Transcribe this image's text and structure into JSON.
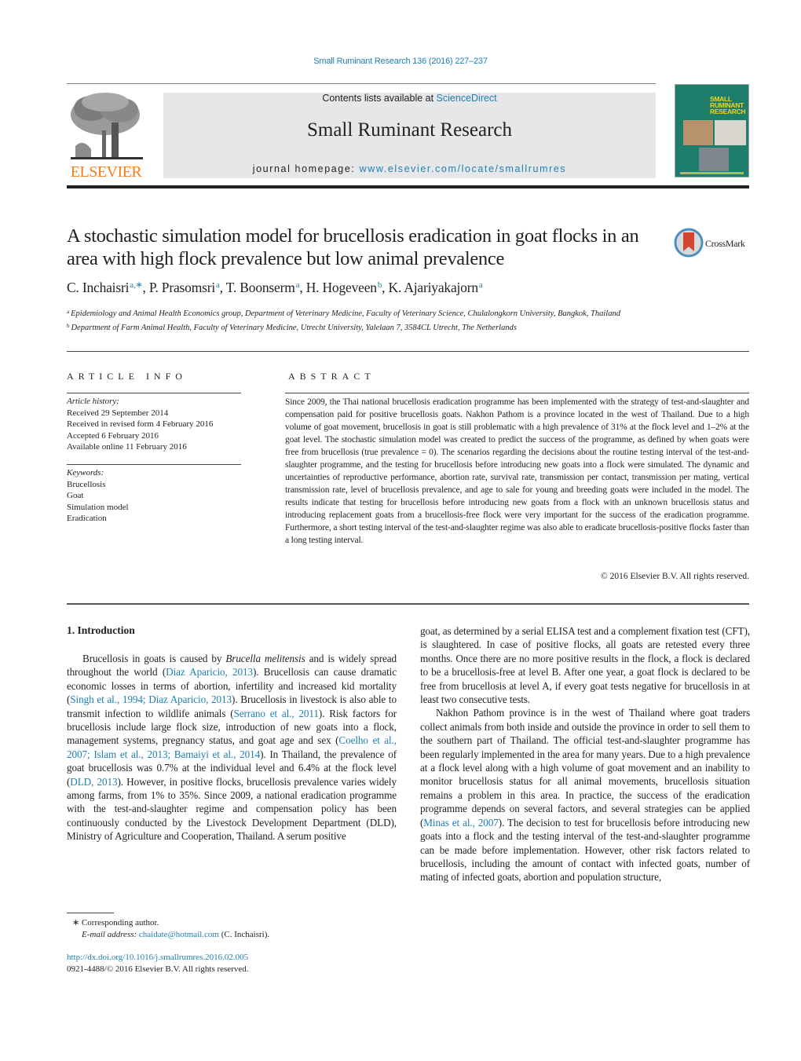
{
  "header": {
    "citation": "Small Ruminant Research 136 (2016) 227–237",
    "contents_prefix": "Contents lists available at ",
    "contents_link": "ScienceDirect",
    "journal_name": "Small Ruminant Research",
    "homepage_prefix": "journal homepage: ",
    "homepage_link": "www.elsevier.com/locate/smallrumres",
    "publisher_logo_text": "ELSEVIER",
    "cover_title_lines": [
      "SMALL",
      "RUMINANT",
      "RESEARCH"
    ],
    "colors": {
      "link": "#1f7fb3",
      "publisher_orange": "#f07f1b",
      "banner_bg": "#e6e7e8",
      "cover_green": "#1f7d6b",
      "cover_yellow": "#f3d21b"
    }
  },
  "article": {
    "title": "A stochastic simulation model for brucellosis eradication in goat flocks in an area with high flock prevalence but low animal prevalence",
    "crossmark_label": "CrossMark",
    "authors": [
      {
        "name": "C. Inchaisri",
        "sup": "a,∗"
      },
      {
        "name": "P. Prasomsri",
        "sup": "a"
      },
      {
        "name": "T. Boonserm",
        "sup": "a"
      },
      {
        "name": "H. Hogeveen",
        "sup": "b"
      },
      {
        "name": "K. Ajariyakajorn",
        "sup": "a"
      }
    ],
    "affiliations": [
      {
        "mark": "a",
        "text": "Epidemiology and Animal Health Economics group, Department of Veterinary Medicine, Faculty of Veterinary Science, Chulalongkorn University, Bangkok, Thailand"
      },
      {
        "mark": "b",
        "text": "Department of Farm Animal Health, Faculty of Veterinary Medicine, Utrecht University, Yalelaan 7, 3584CL Utrecht, The Netherlands"
      }
    ]
  },
  "article_info": {
    "heading": "ARTICLE INFO",
    "history_label": "Article history:",
    "history": [
      "Received 29 September 2014",
      "Received in revised form 4 February 2016",
      "Accepted 6 February 2016",
      "Available online 11 February 2016"
    ],
    "keywords_label": "Keywords:",
    "keywords": [
      "Brucellosis",
      "Goat",
      "Simulation model",
      "Eradication"
    ]
  },
  "abstract": {
    "heading": "ABSTRACT",
    "text": "Since 2009, the Thai national brucellosis eradication programme has been implemented with the strategy of test-and-slaughter and compensation paid for positive brucellosis goats. Nakhon Pathom is a province located in the west of Thailand. Due to a high volume of goat movement, brucellosis in goat is still problematic with a high prevalence of 31% at the flock level and 1–2% at the goat level. The stochastic simulation model was created to predict the success of the programme, as defined by when goats were free from brucellosis (true prevalence = 0). The scenarios regarding the decisions about the routine testing interval of the test-and-slaughter programme, and the testing for brucellosis before introducing new goats into a flock were simulated. The dynamic and uncertainties of reproductive performance, abortion rate, survival rate, transmission per contact, transmission per mating, vertical transmission rate, level of brucellosis prevalence, and age to sale for young and breeding goats were included in the model. The results indicate that testing for brucellosis before introducing new goats from a flock with an unknown brucellosis status and introducing replacement goats from a brucellosis-free flock were very important for the success of the eradication programme. Furthermore, a short testing interval of the test-and-slaughter regime was also able to eradicate brucellosis-positive flocks faster than a long testing interval.",
    "copyright": "© 2016 Elsevier B.V. All rights reserved."
  },
  "body": {
    "section_heading": "1.  Introduction",
    "left_column": [
      {
        "t": "Brucellosis in goats is caused by "
      },
      {
        "t": "Brucella melitensis",
        "style": "italic"
      },
      {
        "t": " and is widely spread throughout the world ("
      },
      {
        "t": "Diaz Aparicio, 2013",
        "style": "link"
      },
      {
        "t": "). Brucellosis can cause dramatic economic losses in terms of abortion, infertility and increased kid mortality ("
      },
      {
        "t": "Singh et al., 1994; Diaz Aparicio, 2013",
        "style": "link"
      },
      {
        "t": "). Brucellosis in livestock is also able to transmit infection to wildlife animals ("
      },
      {
        "t": "Serrano et al., 2011",
        "style": "link"
      },
      {
        "t": "). Risk factors for brucellosis include large flock size, introduction of new goats into a flock, management systems, pregnancy status, and goat age and sex ("
      },
      {
        "t": "Coelho et al., 2007; Islam et al., 2013; Bamaiyi et al., 2014",
        "style": "link"
      },
      {
        "t": "). In Thailand, the prevalence of goat brucellosis was 0.7% at the individual level and 6.4% at the flock level ("
      },
      {
        "t": "DLD, 2013",
        "style": "link"
      },
      {
        "t": "). However, in positive flocks, brucellosis prevalence varies widely among farms, from 1% to 35%. Since 2009, a national eradication programme with the test-and-slaughter regime and compensation policy has been continuously conducted by the Livestock Development Department (DLD), Ministry of Agriculture and Cooperation, Thailand. A serum positive"
      }
    ],
    "right_column_p1": "goat, as determined by a serial ELISA test and a complement fixation test (CFT), is slaughtered. In case of positive flocks, all goats are retested every three months. Once there are no more positive results in the flock, a flock is declared to be a brucellosis-free at level B. After one year, a goat flock is declared to be free from brucellosis at level A, if every goat tests negative for brucellosis in at least two consecutive tests.",
    "right_column_p2": [
      {
        "t": "Nakhon Pathom province is in the west of Thailand where goat traders collect animals from both inside and outside the province in order to sell them to the southern part of Thailand. The official test-and-slaughter programme has been regularly implemented in the area for many years. Due to a high prevalence at a flock level along with a high volume of goat movement and an inability to monitor brucellosis status for all animal movements, brucellosis situation remains a problem in this area. In practice, the success of the eradication programme depends on several factors, and several strategies can be applied ("
      },
      {
        "t": "Minas et al., 2007",
        "style": "link"
      },
      {
        "t": "). The decision to test for brucellosis before introducing new goats into a flock and the testing interval of the test-and-slaughter programme can be made before implementation. However, other risk factors related to brucellosis, including the amount of contact with infected goats, number of mating of infected goats, abortion and population structure,"
      }
    ]
  },
  "footnotes": {
    "corresponding": "∗  Corresponding author.",
    "email_label": "E-mail address: ",
    "email": "chaidate@hotmail.com",
    "email_suffix": " (C. Inchaisri).",
    "doi": "http://dx.doi.org/10.1016/j.smallrumres.2016.02.005",
    "issn": "0921-4488/© 2016 Elsevier B.V. All rights reserved."
  }
}
